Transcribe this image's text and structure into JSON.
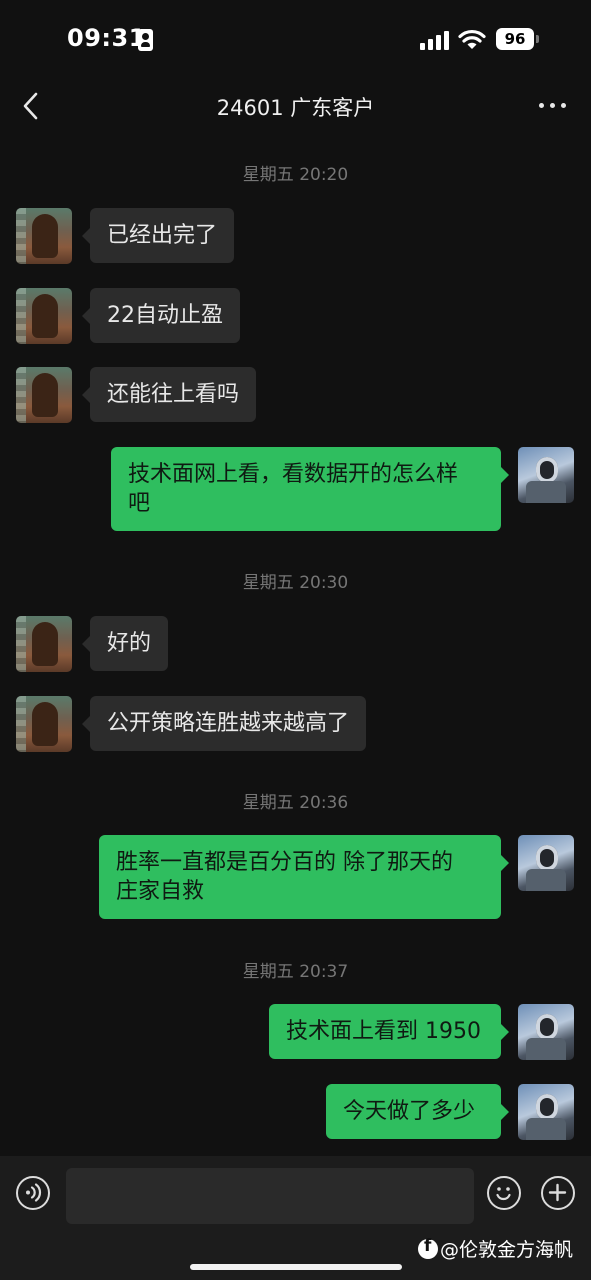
{
  "status_bar": {
    "time": "09:31",
    "battery": "96"
  },
  "header": {
    "title": "24601 广东客户"
  },
  "messages": [
    {
      "type": "timestamp",
      "text": "星期五 20:20"
    },
    {
      "type": "in",
      "text": "已经出完了"
    },
    {
      "type": "in",
      "text": "22自动止盈"
    },
    {
      "type": "in",
      "text": "还能往上看吗"
    },
    {
      "type": "out",
      "line1": "技术面网上看，看数据开的怎么样",
      "line2": "吧"
    },
    {
      "type": "timestamp",
      "text": "星期五 20:30"
    },
    {
      "type": "in",
      "text": "好的"
    },
    {
      "type": "in",
      "text": "公开策略连胜越来越高了"
    },
    {
      "type": "timestamp",
      "text": "星期五 20:36"
    },
    {
      "type": "out",
      "line1": "胜率一直都是百分百的  除了那天的",
      "line2": "庄家自救"
    },
    {
      "type": "timestamp",
      "text": "星期五 20:37"
    },
    {
      "type": "out",
      "text": "技术面上看到 1950"
    },
    {
      "type": "out",
      "text": "今天做了多少"
    }
  ],
  "input_bar": {
    "placeholder": ""
  },
  "watermark": {
    "text": "@伦敦金方海帆"
  },
  "icons": {
    "back": "chevron-left-icon",
    "more": "more-dots-icon",
    "voice": "voice-icon",
    "emoji": "emoji-icon",
    "plus": "plus-icon"
  }
}
